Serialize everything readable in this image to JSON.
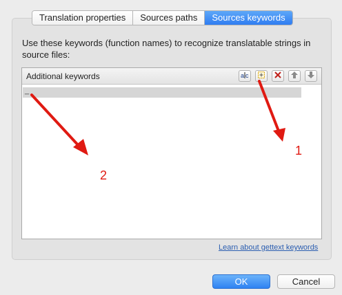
{
  "tabs": [
    {
      "label": "Translation properties",
      "active": false
    },
    {
      "label": "Sources paths",
      "active": false
    },
    {
      "label": "Sources keywords",
      "active": true
    }
  ],
  "description": "Use these keywords (function names) to recognize translatable strings in source files:",
  "keywords_panel": {
    "title": "Additional keywords",
    "toolbar_icons": [
      "edit-text-icon",
      "add-keyword-icon",
      "delete-icon",
      "move-up-icon",
      "move-down-icon"
    ],
    "rows": [
      "_"
    ]
  },
  "help_link": "Learn about gettext keywords",
  "buttons": {
    "ok": "OK",
    "cancel": "Cancel"
  },
  "annotations": {
    "label_1": "1",
    "label_2": "2",
    "color": "#e01a12"
  },
  "colors": {
    "accent": "#2f7df1",
    "link": "#2a5db0"
  }
}
